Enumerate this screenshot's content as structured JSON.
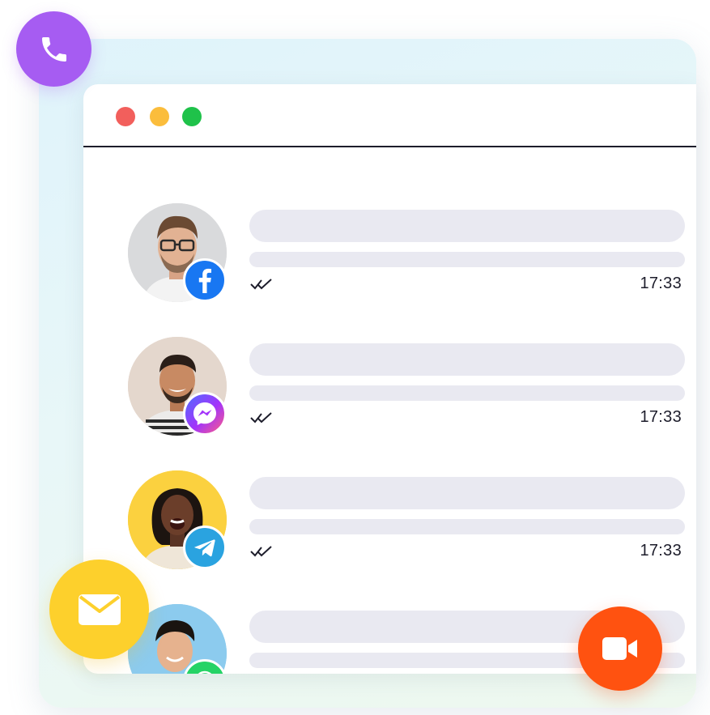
{
  "window": {
    "traffic_lights": [
      {
        "name": "close",
        "color": "#f25f5c"
      },
      {
        "name": "minimize",
        "color": "#fbbd3c"
      },
      {
        "name": "zoom",
        "color": "#1fc24a"
      }
    ]
  },
  "conversations": [
    {
      "channel": "facebook",
      "badge_icon": "facebook-icon",
      "badge_color": "#1877f2",
      "avatar_bg": "#d9dadc",
      "read_status": "double-check-icon",
      "time": "17:33"
    },
    {
      "channel": "messenger",
      "badge_icon": "messenger-icon",
      "badge_color": "#a334fa",
      "avatar_bg": "#e4d7cd",
      "read_status": "double-check-icon",
      "time": "17:33"
    },
    {
      "channel": "telegram",
      "badge_icon": "telegram-icon",
      "badge_color": "#2aa3e0",
      "avatar_bg": "#fbd13f",
      "read_status": "double-check-icon",
      "time": "17:33"
    },
    {
      "channel": "whatsapp",
      "badge_icon": "whatsapp-icon",
      "badge_color": "#25d366",
      "avatar_bg": "#8ccbee",
      "read_status": "",
      "time": ""
    }
  ],
  "floating_actions": {
    "phone": {
      "icon": "phone-icon",
      "color": "#a65cf2"
    },
    "mail": {
      "icon": "mail-icon",
      "color": "#fdd02c"
    },
    "video": {
      "icon": "video-camera-icon",
      "color": "#ff5210"
    }
  }
}
